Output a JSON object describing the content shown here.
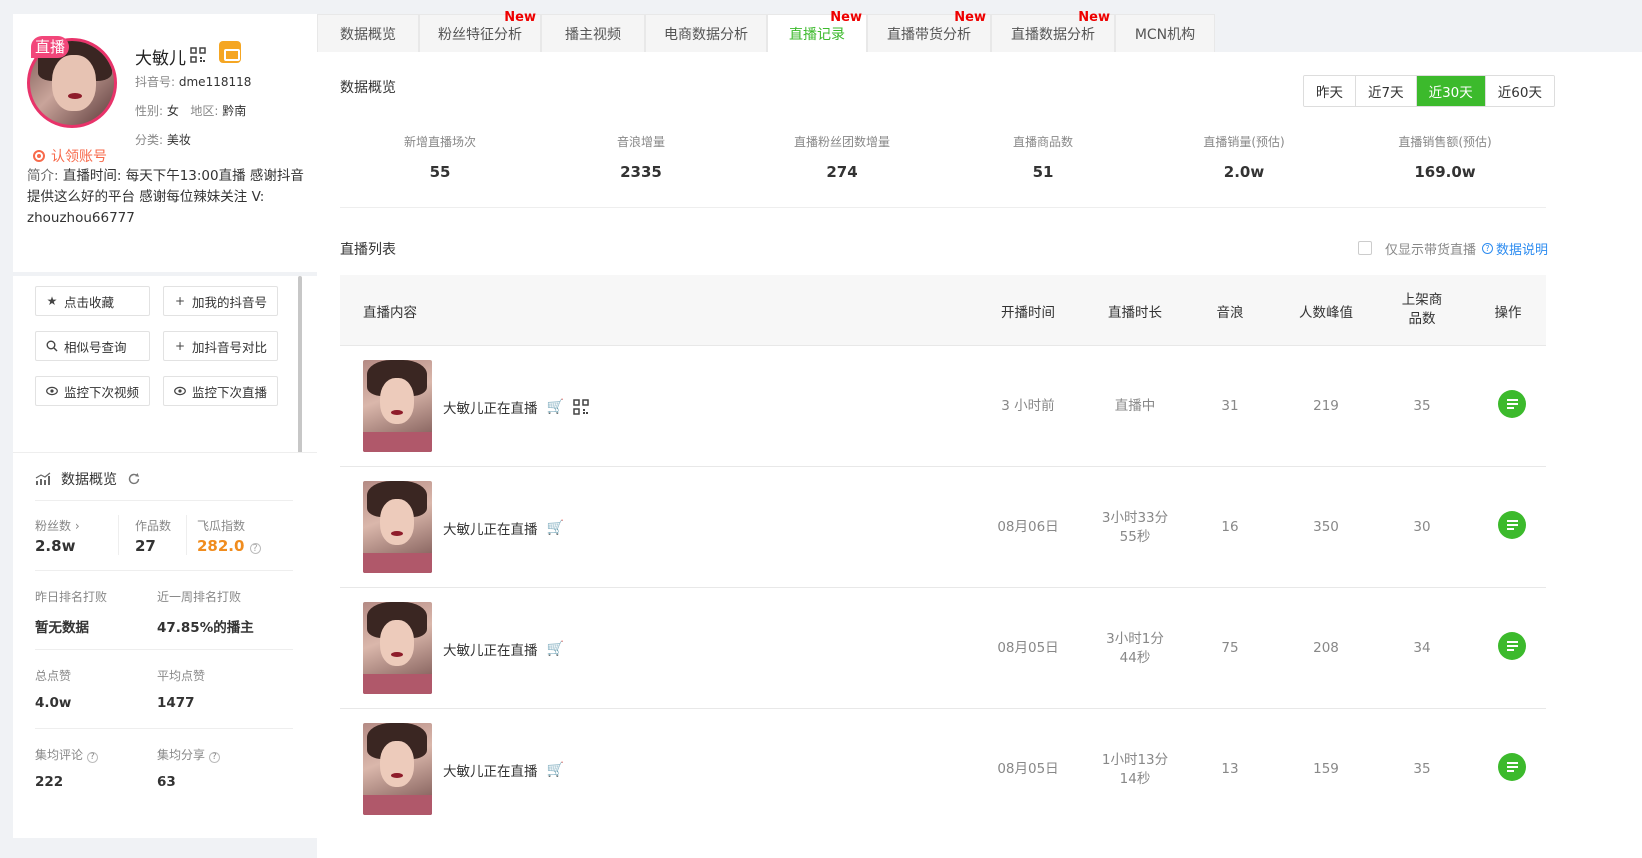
{
  "profile": {
    "live_badge": "直播",
    "name": "大敏儿",
    "douyin_id_label": "抖音号:",
    "douyin_id": "dme118118",
    "gender_label": "性别:",
    "gender": "女",
    "region_label": "地区:",
    "region": "黔南",
    "category_label": "分类:",
    "category": "美妆",
    "claim_label": "认领账号",
    "intro_label": "简介:",
    "intro_text": "直播时间: 每天下午13:00直播 感谢抖音提供这么好的平台 感谢每位辣妹关注 V: zhouzhou66777"
  },
  "actions": {
    "favorite": "点击收藏",
    "add_my": "加我的抖音号",
    "similar": "相似号查询",
    "compare": "加抖音号对比",
    "monitor_video": "监控下次视频",
    "monitor_live": "监控下次直播"
  },
  "overview": {
    "title": "数据概览",
    "fans_label": "粉丝数",
    "fans": "2.8w",
    "works_label": "作品数",
    "works": "27",
    "index_label": "飞瓜指数",
    "index": "282.0",
    "yday_rank_label": "昨日排名打败",
    "yday_rank": "暂无数据",
    "week_rank_label": "近一周排名打败",
    "week_rank": "47.85%的播主",
    "total_likes_label": "总点赞",
    "total_likes": "4.0w",
    "avg_likes_label": "平均点赞",
    "avg_likes": "1477",
    "avg_comments_label": "集均评论",
    "avg_comments": "222",
    "avg_shares_label": "集均分享",
    "avg_shares": "63"
  },
  "tabs": [
    {
      "label": "数据概览",
      "new": ""
    },
    {
      "label": "粉丝特征分析",
      "new": "New"
    },
    {
      "label": "播主视频",
      "new": ""
    },
    {
      "label": "电商数据分析",
      "new": ""
    },
    {
      "label": "直播记录",
      "new": "New"
    },
    {
      "label": "直播带货分析",
      "new": "New"
    },
    {
      "label": "直播数据分析",
      "new": "New"
    },
    {
      "label": "MCN机构",
      "new": ""
    }
  ],
  "main": {
    "overview_title": "数据概览",
    "ranges": [
      "昨天",
      "近7天",
      "近30天",
      "近60天"
    ],
    "kpis": [
      {
        "label": "新增直播场次",
        "value": "55"
      },
      {
        "label": "音浪增量",
        "value": "2335"
      },
      {
        "label": "直播粉丝团数增量",
        "value": "274"
      },
      {
        "label": "直播商品数",
        "value": "51"
      },
      {
        "label": "直播销量(预估)",
        "value": "2.0w"
      },
      {
        "label": "直播销售额(预估)",
        "value": "169.0w"
      }
    ],
    "list_title": "直播列表",
    "only_goods": "仅显示带货直播",
    "data_help": "数据说明",
    "columns": {
      "content": "直播内容",
      "start": "开播时间",
      "duration": "直播时长",
      "sound": "音浪",
      "peak": "人数峰值",
      "goods": "上架商品数",
      "op": "操作"
    },
    "rows": [
      {
        "title": "大敏儿正在直播",
        "start": "3 小时前",
        "duration": "直播中",
        "sound": "31",
        "peak": "219",
        "goods": "35"
      },
      {
        "title": "大敏儿正在直播",
        "start": "08月06日",
        "duration": "3小时33分55秒",
        "sound": "16",
        "peak": "350",
        "goods": "30"
      },
      {
        "title": "大敏儿正在直播",
        "start": "08月05日",
        "duration": "3小时1分44秒",
        "sound": "75",
        "peak": "208",
        "goods": "34"
      },
      {
        "title": "大敏儿正在直播",
        "start": "08月05日",
        "duration": "1小时13分14秒",
        "sound": "13",
        "peak": "159",
        "goods": "35"
      }
    ]
  },
  "colors": {
    "accent": "#3cba2c",
    "new": "#ee0000",
    "orange": "#f08c1e",
    "link": "#2d8cf0",
    "live": "#f2467a"
  }
}
